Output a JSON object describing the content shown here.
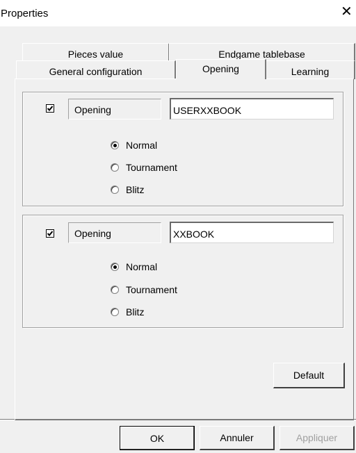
{
  "window": {
    "title": "Properties",
    "close_glyph": "✕"
  },
  "tabs": {
    "row1": [
      {
        "label": "Pieces value"
      },
      {
        "label": "Endgame tablebase"
      }
    ],
    "row2": [
      {
        "label": "General configuration"
      },
      {
        "label": "Opening",
        "active": true
      },
      {
        "label": "Learning"
      }
    ]
  },
  "groups": [
    {
      "checked": true,
      "label": "Opening",
      "value": "USERXXBOOK",
      "options": [
        "Normal",
        "Tournament",
        "Blitz"
      ],
      "selected": "Normal"
    },
    {
      "checked": true,
      "label": "Opening",
      "value": "XXBOOK",
      "options": [
        "Normal",
        "Tournament",
        "Blitz"
      ],
      "selected": "Normal"
    }
  ],
  "buttons": {
    "default": "Default",
    "ok": "OK",
    "cancel": "Annuler",
    "apply": "Appliquer"
  },
  "icons": {
    "close": "close-icon",
    "check": "checkmark-icon"
  }
}
